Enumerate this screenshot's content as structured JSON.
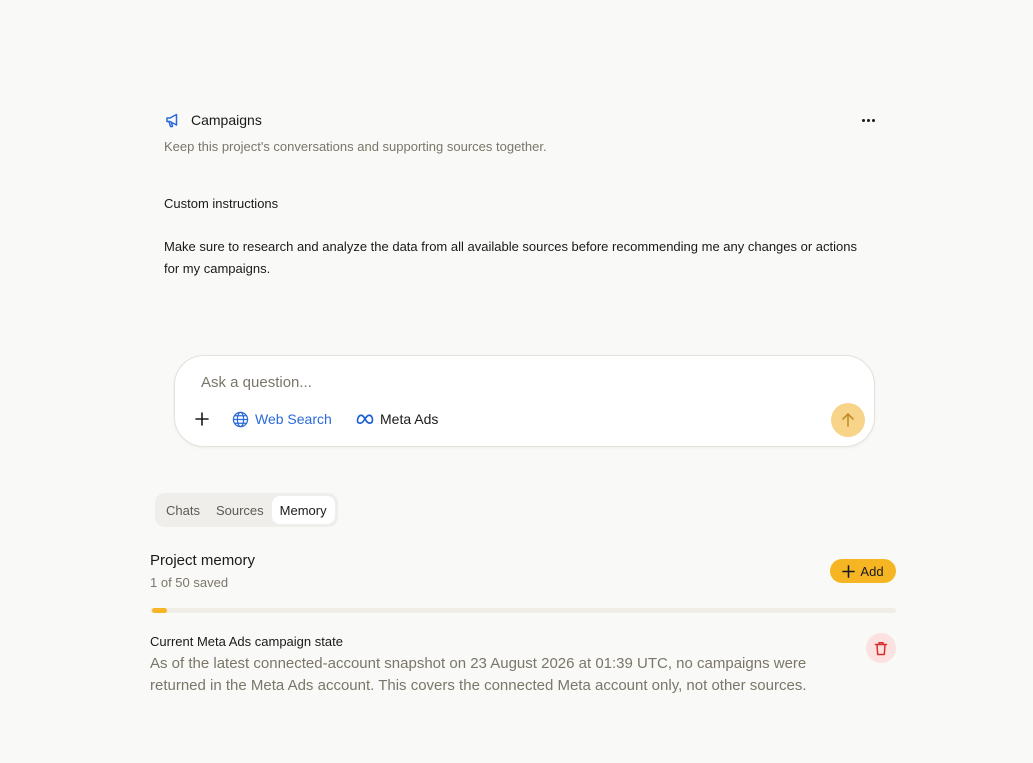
{
  "project": {
    "title": "Campaigns",
    "subtitle": "Keep this project's conversations and supporting sources together.",
    "icon": "megaphone-icon"
  },
  "custom_instructions": {
    "title": "Custom instructions",
    "body": "Make sure to research and analyze the data from all available sources before recommending me any changes or actions for my campaigns."
  },
  "composer": {
    "placeholder": "Ask a question...",
    "web_search_label": "Web Search",
    "meta_ads_label": "Meta Ads"
  },
  "tabs": [
    {
      "label": "Chats"
    },
    {
      "label": "Sources"
    },
    {
      "label": "Memory"
    }
  ],
  "active_tab": "Memory",
  "memory": {
    "title": "Project memory",
    "count_text": "1 of 50 saved",
    "saved": 1,
    "limit": 50,
    "add_label": "Add",
    "items": [
      {
        "title": "Current Meta Ads campaign state",
        "body": "As of the latest connected-account snapshot on 23 August 2026 at 01:39 UTC, no campaigns were returned in the Meta Ads account. This covers the connected Meta account only, not other sources."
      }
    ]
  },
  "colors": {
    "accent": "#f6b623",
    "send_button": "#f8d48a",
    "link_blue": "#2a6ad9",
    "delete_bg": "#fbe2e1",
    "delete_icon": "#d92d2d"
  }
}
